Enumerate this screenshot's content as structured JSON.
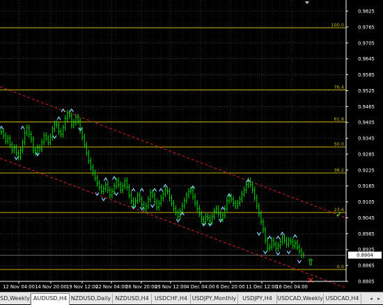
{
  "colors": {
    "background": "#000000",
    "grid": "#5a5a5a",
    "fib": "#c8b400",
    "channel": "#d02020",
    "price_line": "#00e000",
    "fractal": "#87d6ff",
    "axis_text": "#ffffff"
  },
  "fib_levels": [
    {
      "label": "100.0",
      "price": 0.9762
    },
    {
      "label": "76.4",
      "price": 0.9528
    },
    {
      "label": "61.8",
      "price": 0.9407
    },
    {
      "label": "50.0",
      "price": 0.9312
    },
    {
      "label": "38.2",
      "price": 0.9214
    },
    {
      "label": "23.6",
      "price": 0.9065
    },
    {
      "label": "0.0",
      "price": 0.885
    }
  ],
  "price_axis": {
    "ticks": [
      "0.9825",
      "0.9765",
      "0.9705",
      "0.9645",
      "0.9585",
      "0.9525",
      "0.9465",
      "0.9405",
      "0.9345",
      "0.9285",
      "0.9225",
      "0.9165",
      "0.9105",
      "0.9045",
      "0.8985",
      "0.8925",
      "0.8865",
      "0.8805"
    ],
    "current_price": "0.8904"
  },
  "time_axis": {
    "labels": [
      "12 Nov 04:00",
      "14 Nov 20:00",
      "19 Nov 12:00",
      "22 Nov 04:00",
      "26 Nov 20:00",
      "29 Nov 12:00",
      "4 Dec 04:00",
      "6 Dec 20:00",
      "11 Dec 12:00",
      "16 Dec 04:00"
    ]
  },
  "tabs": [
    {
      "label": "SD,Weekly",
      "active": false
    },
    {
      "label": "AUDUSD,H4",
      "active": true
    },
    {
      "label": "NZDUSD,Daily",
      "active": false
    },
    {
      "label": "NZDUSD,H4",
      "active": false
    },
    {
      "label": "USDCHF,H4",
      "active": false
    },
    {
      "label": "USDJPY,Monthly",
      "active": false
    },
    {
      "label": "USDJPY,H4",
      "active": false
    },
    {
      "label": "USDCAD,Weekly",
      "active": false
    },
    {
      "label": "USDCAD,H4",
      "active": false
    }
  ],
  "scroll_left": "◂",
  "scroll_right": "▸",
  "price_series": [
    0.937,
    0.9355,
    0.9335,
    0.9345,
    0.932,
    0.93,
    0.931,
    0.929,
    0.9275,
    0.93,
    0.933,
    0.9365,
    0.9385,
    0.936,
    0.934,
    0.93,
    0.929,
    0.931,
    0.9305,
    0.933,
    0.9355,
    0.9345,
    0.933,
    0.935,
    0.938,
    0.94,
    0.9395,
    0.937,
    0.936,
    0.9385,
    0.942,
    0.944,
    0.943,
    0.9395,
    0.9405,
    0.9425,
    0.941,
    0.9375,
    0.935,
    0.932,
    0.929,
    0.926,
    0.9235,
    0.9215,
    0.9195,
    0.9175,
    0.916,
    0.9145,
    0.9155,
    0.917,
    0.915,
    0.913,
    0.9145,
    0.9165,
    0.9185,
    0.917,
    0.915,
    0.9165,
    0.9185,
    0.916,
    0.913,
    0.911,
    0.9095,
    0.911,
    0.913,
    0.9115,
    0.9095,
    0.908,
    0.909,
    0.9115,
    0.914,
    0.913,
    0.9105,
    0.9085,
    0.91,
    0.912,
    0.9135,
    0.915,
    0.9145,
    0.912,
    0.91,
    0.908,
    0.9065,
    0.905,
    0.907,
    0.909,
    0.911,
    0.913,
    0.9145,
    0.915,
    0.9125,
    0.91,
    0.908,
    0.906,
    0.904,
    0.903,
    0.905,
    0.9045,
    0.903,
    0.905,
    0.907,
    0.908,
    0.906,
    0.904,
    0.9055,
    0.908,
    0.911,
    0.9125,
    0.9115,
    0.91,
    0.909,
    0.91,
    0.9115,
    0.9135,
    0.915,
    0.917,
    0.9185,
    0.917,
    0.915,
    0.912,
    0.909,
    0.906,
    0.903,
    0.9,
    0.896,
    0.893,
    0.8935,
    0.896,
    0.8945,
    0.893,
    0.894,
    0.8955,
    0.897,
    0.896,
    0.8945,
    0.896,
    0.8955,
    0.894,
    0.895,
    0.8935,
    0.892,
    0.8905,
    0.8904
  ],
  "fractals_up": [
    [
      0,
      9385
    ],
    [
      10,
      9385
    ],
    [
      27,
      9420
    ],
    [
      29,
      9450
    ],
    [
      33,
      9450
    ],
    [
      49,
      9190
    ],
    [
      53,
      9195
    ],
    [
      62,
      9150
    ],
    [
      66,
      9150
    ],
    [
      72,
      9150
    ],
    [
      75,
      9150
    ],
    [
      77,
      9165
    ],
    [
      85,
      9060
    ],
    [
      90,
      9160
    ],
    [
      104,
      9080
    ],
    [
      107,
      9130
    ],
    [
      116,
      9185
    ],
    [
      126,
      8970
    ],
    [
      130,
      8970
    ],
    [
      132,
      8985
    ],
    [
      138,
      8975
    ]
  ],
  "fractals_down": [
    [
      7,
      9270
    ],
    [
      17,
      9285
    ],
    [
      25,
      9350
    ],
    [
      37,
      9380
    ],
    [
      45,
      9135
    ],
    [
      48,
      9115
    ],
    [
      54,
      9135
    ],
    [
      62,
      9085
    ],
    [
      66,
      9080
    ],
    [
      71,
      9090
    ],
    [
      83,
      9035
    ],
    [
      95,
      9020
    ],
    [
      98,
      9020
    ],
    [
      103,
      9035
    ],
    [
      121,
      8985
    ],
    [
      124,
      8915
    ],
    [
      130,
      8910
    ],
    [
      135,
      8915
    ],
    [
      140,
      8880
    ]
  ],
  "channel_upper": [
    [
      0,
      0.954
    ],
    [
      143,
      0.9045
    ]
  ],
  "channel_lower": [
    [
      0,
      0.927
    ],
    [
      143,
      0.878
    ]
  ],
  "signals": [
    {
      "name": "check-signal-icon",
      "glyph": "✓",
      "color": "#44dd22",
      "idx": 136,
      "price": 0.906
    },
    {
      "name": "up-arrow-signal-icon",
      "glyph": "⇧",
      "color": "#22dd22",
      "idx": 126,
      "price": 0.888
    },
    {
      "name": "cross-signal-icon",
      "glyph": "✕",
      "color": "#ff2020",
      "idx": 126,
      "price": 0.881
    }
  ]
}
